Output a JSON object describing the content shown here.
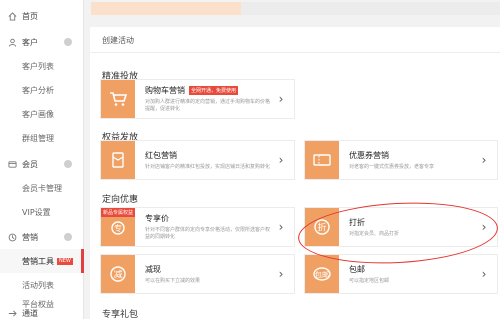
{
  "sidebar": {
    "home": "首页",
    "customer": "客户",
    "customer_list": "客户列表",
    "customer_analysis": "客户分析",
    "customer_portrait": "客户画像",
    "group_manage": "群组管理",
    "member": "会员",
    "member_card_manage": "会员卡管理",
    "vip_settings": "VIP设置",
    "marketing": "营销",
    "marketing_tools": "营销工具",
    "marketing_tools_badge": "NEW",
    "activity_list": "活动列表",
    "platform_rights": "平台权益",
    "channel": "通道"
  },
  "breadcrumb": "创建活动",
  "sections": {
    "precise": "精准投放",
    "rights": "权益发放",
    "directed": "定向优惠",
    "exclusive": "专享礼包"
  },
  "cards": {
    "cart": {
      "name": "购物车营销",
      "tag": "全网开通，免费使用",
      "desc": "对加购人群进行精准的定向营销，通过手淘购物车的价格提醒，促进转化"
    },
    "redpacket": {
      "name": "红包营销",
      "desc": "针对店铺客户的精准红包投放，实现店铺日活和复购转化"
    },
    "coupon": {
      "name": "优惠券营销",
      "desc": "对老客的一键式优惠券投放，老客专享"
    },
    "exclusive_price": {
      "name": "专享价",
      "thumb_tag": "新品专属权益",
      "desc": "针对不同客户群体的定向专享价格活动，仅限所选客户权益的同期转化"
    },
    "discount": {
      "name": "打折",
      "desc": "对指定会员、商品打折"
    },
    "reduce": {
      "name": "减现",
      "desc": "可以在购买下立减的效果"
    },
    "shipping": {
      "name": "包邮",
      "desc": "可以指定地区包邮"
    }
  },
  "colors": {
    "accent": "#f0a062",
    "tag_red": "#e84a3c",
    "annotation": "#e3342f"
  }
}
